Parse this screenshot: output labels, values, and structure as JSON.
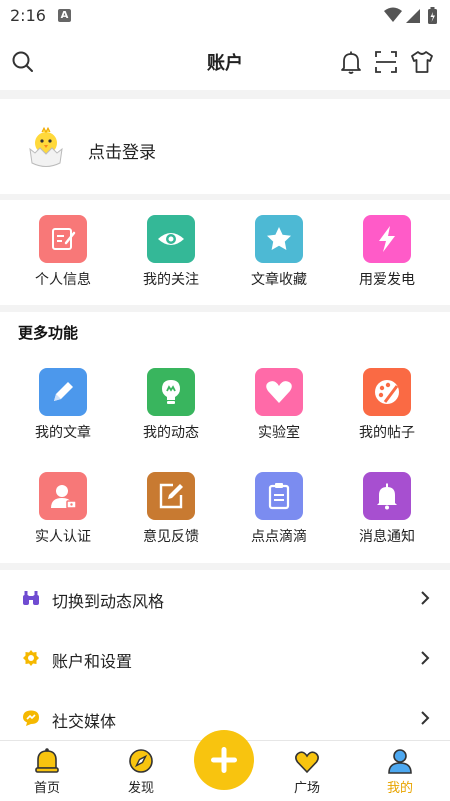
{
  "status_bar": {
    "time": "2:16",
    "notification_letter": "A"
  },
  "header": {
    "title": "账户"
  },
  "login": {
    "text": "点击登录"
  },
  "quick_actions": [
    {
      "label": "个人信息",
      "icon": "edit-note-icon",
      "color": "#f87878"
    },
    {
      "label": "我的关注",
      "icon": "eye-icon",
      "color": "#34b897"
    },
    {
      "label": "文章收藏",
      "icon": "star-icon",
      "color": "#4db9d4"
    },
    {
      "label": "用爱发电",
      "icon": "lightning-icon",
      "color": "#ff5bc8"
    }
  ],
  "more_functions": {
    "title": "更多功能",
    "items": [
      {
        "label": "我的文章",
        "icon": "pencil-icon",
        "color": "#4c98ec"
      },
      {
        "label": "我的动态",
        "icon": "bulb-icon",
        "color": "#39b55e"
      },
      {
        "label": "实验室",
        "icon": "heart-icon",
        "color": "#ff6aa8"
      },
      {
        "label": "我的帖子",
        "icon": "palette-icon",
        "color": "#fa6a44"
      },
      {
        "label": "实人认证",
        "icon": "id-person-icon",
        "color": "#f77878"
      },
      {
        "label": "意见反馈",
        "icon": "feedback-edit-icon",
        "color": "#c87a31"
      },
      {
        "label": "点点滴滴",
        "icon": "clipboard-icon",
        "color": "#7b8cf0"
      },
      {
        "label": "消息通知",
        "icon": "bell-icon",
        "color": "#a74fd0"
      }
    ]
  },
  "menu": [
    {
      "label": "切换到动态风格",
      "icon": "binoculars-icon",
      "color": "#6f4bd1"
    },
    {
      "label": "账户和设置",
      "icon": "settings-gear-icon",
      "color": "#f5b800"
    },
    {
      "label": "社交媒体",
      "icon": "chat-bubble-icon",
      "color": "#f5b800"
    }
  ],
  "bottom_nav": [
    {
      "label": "首页",
      "icon": "bell-home-icon"
    },
    {
      "label": "发现",
      "icon": "compass-icon"
    },
    {
      "label": "广场",
      "icon": "heart-outline-icon"
    },
    {
      "label": "我的",
      "icon": "person-icon",
      "active": true
    }
  ],
  "colors": {
    "accent": "#f8c40f",
    "active_nav": "#e8a400"
  }
}
